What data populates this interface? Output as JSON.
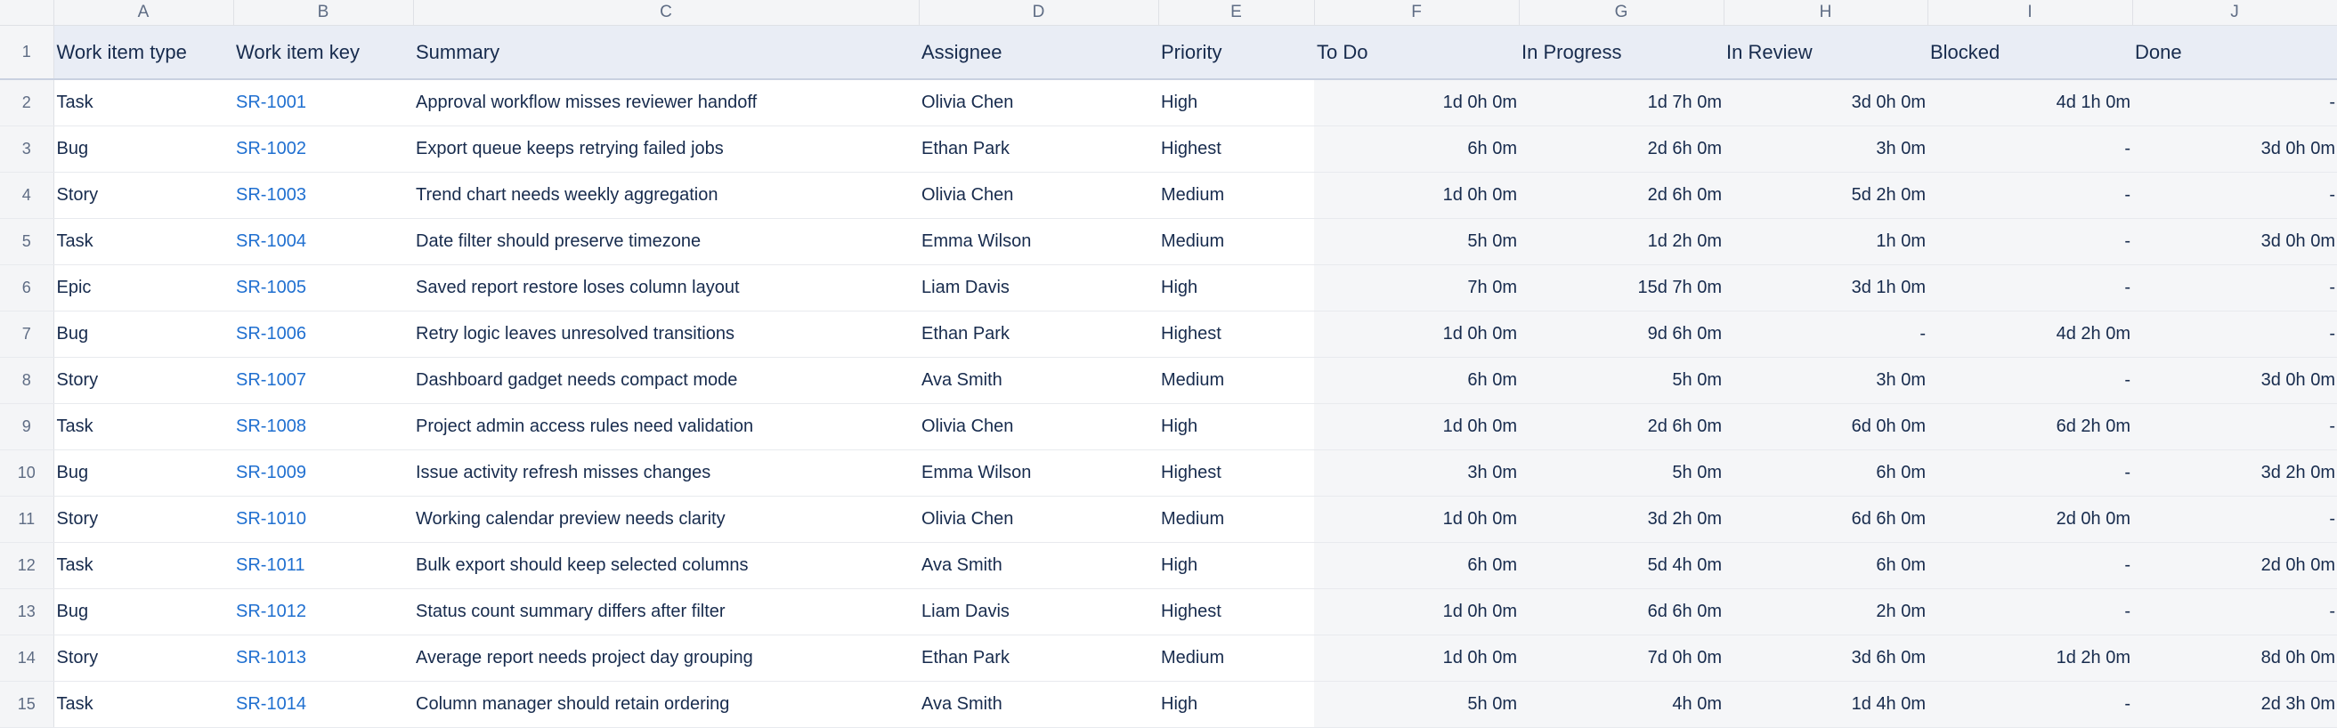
{
  "sheet": {
    "column_letters": [
      "A",
      "B",
      "C",
      "D",
      "E",
      "F",
      "G",
      "H",
      "I",
      "J"
    ],
    "headers": [
      "Work item type",
      "Work item key",
      "Summary",
      "Assignee",
      "Priority",
      "To Do",
      "In Progress",
      "In Review",
      "Blocked",
      "Done"
    ],
    "row_numbers": [
      "1",
      "2",
      "3",
      "4",
      "5",
      "6",
      "7",
      "8",
      "9",
      "10",
      "11",
      "12",
      "13",
      "14",
      "15"
    ],
    "rows": [
      [
        "Task",
        "SR-1001",
        "Approval workflow misses reviewer handoff",
        "Olivia Chen",
        "High",
        "1d 0h 0m",
        "1d 7h 0m",
        "3d 0h 0m",
        "4d 1h 0m",
        "-"
      ],
      [
        "Bug",
        "SR-1002",
        "Export queue keeps retrying failed jobs",
        "Ethan Park",
        "Highest",
        "6h 0m",
        "2d 6h 0m",
        "3h 0m",
        "-",
        "3d 0h 0m"
      ],
      [
        "Story",
        "SR-1003",
        "Trend chart needs weekly aggregation",
        "Olivia Chen",
        "Medium",
        "1d 0h 0m",
        "2d 6h 0m",
        "5d 2h 0m",
        "-",
        "-"
      ],
      [
        "Task",
        "SR-1004",
        "Date filter should preserve timezone",
        "Emma Wilson",
        "Medium",
        "5h 0m",
        "1d 2h 0m",
        "1h 0m",
        "-",
        "3d 0h 0m"
      ],
      [
        "Epic",
        "SR-1005",
        "Saved report restore loses column layout",
        "Liam Davis",
        "High",
        "7h 0m",
        "15d 7h 0m",
        "3d 1h 0m",
        "-",
        "-"
      ],
      [
        "Bug",
        "SR-1006",
        "Retry logic leaves unresolved transitions",
        "Ethan Park",
        "Highest",
        "1d 0h 0m",
        "9d 6h 0m",
        "-",
        "4d 2h 0m",
        "-"
      ],
      [
        "Story",
        "SR-1007",
        "Dashboard gadget needs compact mode",
        "Ava Smith",
        "Medium",
        "6h 0m",
        "5h 0m",
        "3h 0m",
        "-",
        "3d 0h 0m"
      ],
      [
        "Task",
        "SR-1008",
        "Project admin access rules need validation",
        "Olivia Chen",
        "High",
        "1d 0h 0m",
        "2d 6h 0m",
        "6d 0h 0m",
        "6d 2h 0m",
        "-"
      ],
      [
        "Bug",
        "SR-1009",
        "Issue activity refresh misses changes",
        "Emma Wilson",
        "Highest",
        "3h 0m",
        "5h 0m",
        "6h 0m",
        "-",
        "3d 2h 0m"
      ],
      [
        "Story",
        "SR-1010",
        "Working calendar preview needs clarity",
        "Olivia Chen",
        "Medium",
        "1d 0h 0m",
        "3d 2h 0m",
        "6d 6h 0m",
        "2d 0h 0m",
        "-"
      ],
      [
        "Task",
        "SR-1011",
        "Bulk export should keep selected columns",
        "Ava Smith",
        "High",
        "6h 0m",
        "5d 4h 0m",
        "6h 0m",
        "-",
        "2d 0h 0m"
      ],
      [
        "Bug",
        "SR-1012",
        "Status count summary differs after filter",
        "Liam Davis",
        "Highest",
        "1d 0h 0m",
        "6d 6h 0m",
        "2h 0m",
        "-",
        "-"
      ],
      [
        "Story",
        "SR-1013",
        "Average report needs project day grouping",
        "Ethan Park",
        "Medium",
        "1d 0h 0m",
        "7d 0h 0m",
        "3d 6h 0m",
        "1d 2h 0m",
        "8d 0h 0m"
      ],
      [
        "Task",
        "SR-1014",
        "Column manager should retain ordering",
        "Ava Smith",
        "High",
        "5h 0m",
        "4h 0m",
        "1d 4h 0m",
        "-",
        "2d 3h 0m"
      ]
    ]
  },
  "colors": {
    "link": "#1f6fd0",
    "header_bg": "#e9edf5",
    "time_cell_bg": "#f5f6f8",
    "text": "#172b4d"
  }
}
